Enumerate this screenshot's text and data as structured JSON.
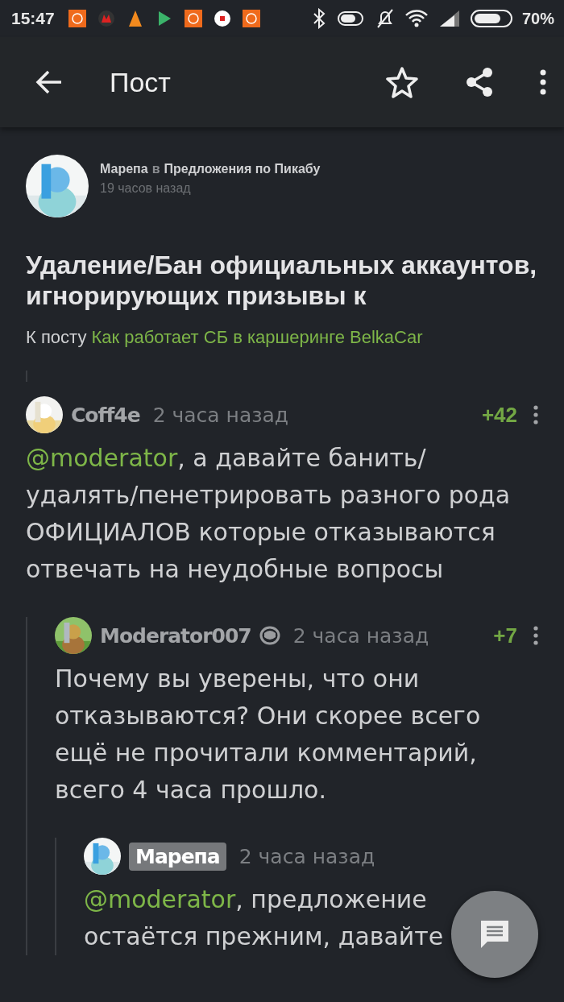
{
  "status_bar": {
    "time": "15:47",
    "battery": "70%"
  },
  "app_bar": {
    "title": "Пост"
  },
  "post": {
    "author": "Марепа",
    "joiner": "в",
    "community": "Предложения по Пикабу",
    "time": "19 часов назад",
    "title": "Удаление/Бан официальных аккаунтов, игнорирующих призывы к",
    "ref_label": "К посту",
    "ref_link": "Как работает СБ в каршеринге BelkaCar"
  },
  "comments": [
    {
      "author": "Coff4e",
      "author_highlight": false,
      "time": "2 часа назад",
      "rating": "+42",
      "mention": "@moderator",
      "text": ", а давайте банить/ удалять/пенетрировать разного рода ОФИЦИАЛОВ которые отказываются отвечать на неудобные вопросы",
      "children": [
        {
          "author": "Moderator007",
          "author_highlight": false,
          "moderator_badge": true,
          "time": "2 часа назад",
          "rating": "+7",
          "text": "Почему вы уверены, что они отказываются? Они скорее всего ещё не прочитали комментарий, всего 4 часа прошло.",
          "children": [
            {
              "author": "Марепа",
              "author_highlight": true,
              "time": "2 часа назад",
              "mention": "@moderator",
              "text": ", предложение остаётся прежним, давайте"
            }
          ]
        }
      ]
    }
  ]
}
